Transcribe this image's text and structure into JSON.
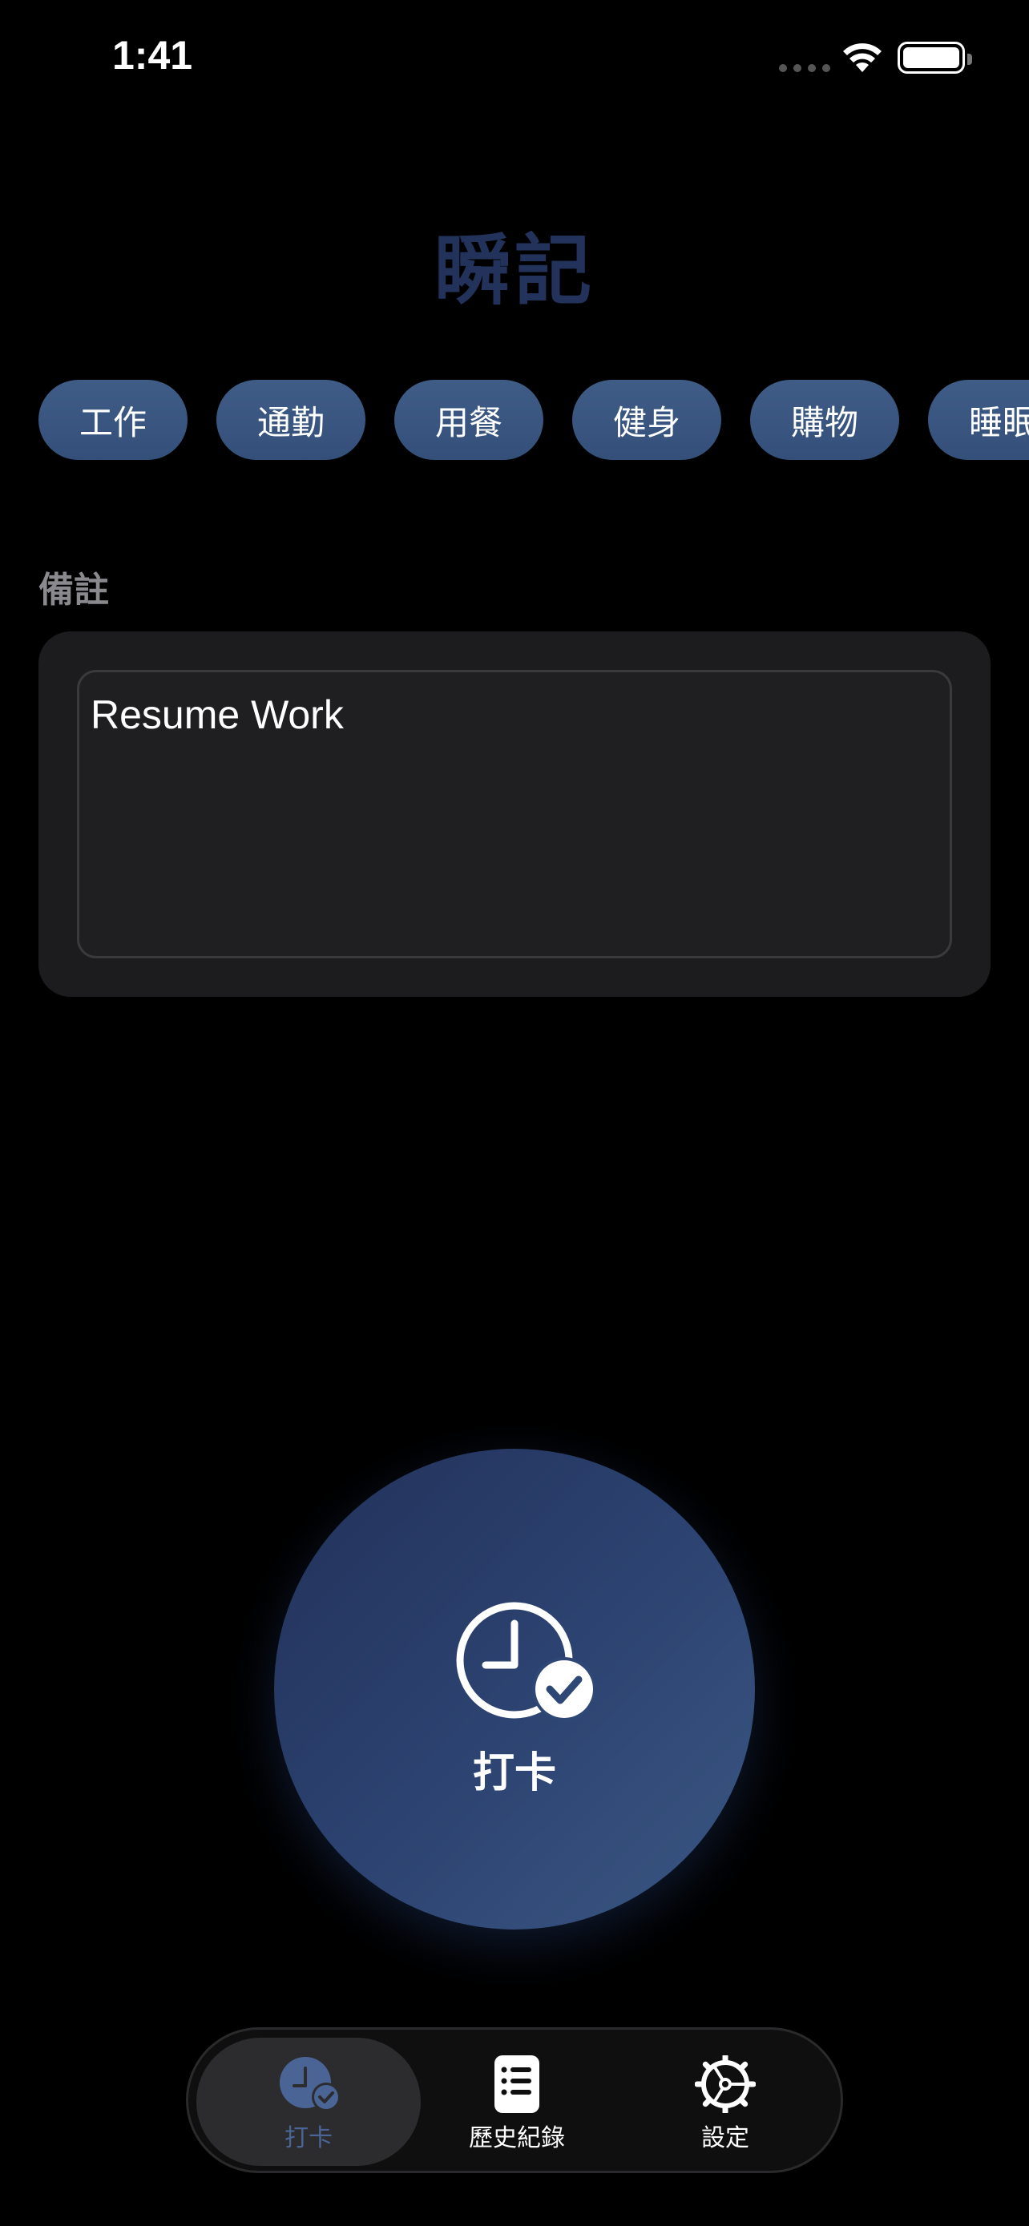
{
  "status_bar": {
    "time": "1:41"
  },
  "app_title": "瞬記",
  "categories": [
    "工作",
    "通勤",
    "用餐",
    "健身",
    "購物",
    "睡眠"
  ],
  "note": {
    "label": "備註",
    "value": "Resume Work"
  },
  "punch_button": {
    "label": "打卡",
    "icon": "clock-check-icon"
  },
  "tab_bar": {
    "items": [
      {
        "label": "打卡",
        "icon": "clock-check-icon",
        "active": true
      },
      {
        "label": "歷史紀錄",
        "icon": "list-document-icon",
        "active": false
      },
      {
        "label": "設定",
        "icon": "gear-icon",
        "active": false
      }
    ]
  },
  "colors": {
    "accent": "#3b5783",
    "chip": "#3a5681",
    "title": "#22325a",
    "background": "#000000",
    "card": "#1c1c1e"
  }
}
